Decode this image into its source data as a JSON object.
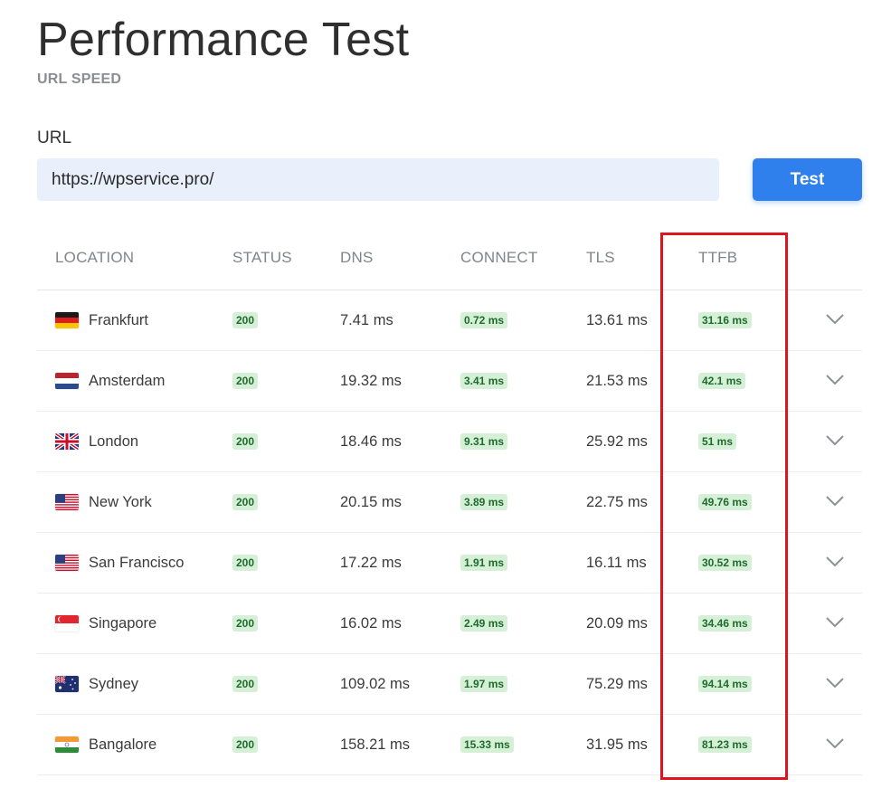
{
  "page": {
    "title": "Performance Test",
    "subtitle": "URL SPEED"
  },
  "form": {
    "url_label": "URL",
    "url_value": "https://wpservice.pro/",
    "test_button": "Test"
  },
  "table": {
    "headers": {
      "location": "LOCATION",
      "status": "STATUS",
      "dns": "DNS",
      "connect": "CONNECT",
      "tls": "TLS",
      "ttfb": "TTFB"
    },
    "rows": [
      {
        "flag": "germany-flag-icon",
        "location": "Frankfurt",
        "status": "200",
        "dns": "7.41 ms",
        "connect": "0.72 ms",
        "tls": "13.61 ms",
        "ttfb": "31.16 ms"
      },
      {
        "flag": "netherlands-flag-icon",
        "location": "Amsterdam",
        "status": "200",
        "dns": "19.32 ms",
        "connect": "3.41 ms",
        "tls": "21.53 ms",
        "ttfb": "42.1 ms"
      },
      {
        "flag": "uk-flag-icon",
        "location": "London",
        "status": "200",
        "dns": "18.46 ms",
        "connect": "9.31 ms",
        "tls": "25.92 ms",
        "ttfb": "51 ms"
      },
      {
        "flag": "usa-flag-icon",
        "location": "New York",
        "status": "200",
        "dns": "20.15 ms",
        "connect": "3.89 ms",
        "tls": "22.75 ms",
        "ttfb": "49.76 ms"
      },
      {
        "flag": "usa-flag-icon",
        "location": "San Francisco",
        "status": "200",
        "dns": "17.22 ms",
        "connect": "1.91 ms",
        "tls": "16.11 ms",
        "ttfb": "30.52 ms"
      },
      {
        "flag": "singapore-flag-icon",
        "location": "Singapore",
        "status": "200",
        "dns": "16.02 ms",
        "connect": "2.49 ms",
        "tls": "20.09 ms",
        "ttfb": "34.46 ms"
      },
      {
        "flag": "australia-flag-icon",
        "location": "Sydney",
        "status": "200",
        "dns": "109.02 ms",
        "connect": "1.97 ms",
        "tls": "75.29 ms",
        "ttfb": "94.14 ms"
      },
      {
        "flag": "india-flag-icon",
        "location": "Bangalore",
        "status": "200",
        "dns": "158.21 ms",
        "connect": "15.33 ms",
        "tls": "31.95 ms",
        "ttfb": "81.23 ms"
      }
    ]
  },
  "colors": {
    "accent": "#2f80ed",
    "badge_bg": "#d6f0d8",
    "badge_text": "#1f6b2c",
    "highlight": "#e0141e"
  }
}
